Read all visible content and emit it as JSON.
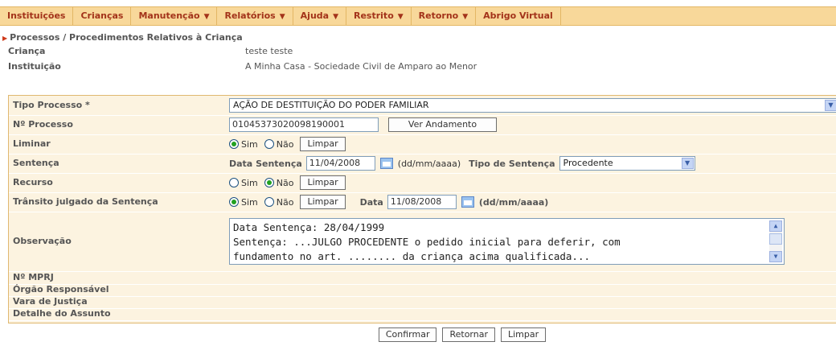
{
  "menu": [
    {
      "label": "Instituições",
      "caret": false
    },
    {
      "label": "Crianças",
      "caret": false
    },
    {
      "label": "Manutenção",
      "caret": true
    },
    {
      "label": "Relatórios",
      "caret": true
    },
    {
      "label": "Ajuda",
      "caret": true
    },
    {
      "label": "Restrito",
      "caret": true
    },
    {
      "label": "Retorno",
      "caret": true
    },
    {
      "label": "Abrigo Virtual",
      "caret": false
    }
  ],
  "breadcrumb": "Processos / Procedimentos Relativos à Criança",
  "header": {
    "crianca_label": "Criança",
    "crianca_value": "teste teste",
    "instituicao_label": "Instituição",
    "instituicao_value": "A Minha Casa - Sociedade Civil de Amparo ao Menor"
  },
  "form": {
    "tipo_processo_label": "Tipo Processo *",
    "tipo_processo_value": "AÇÃO DE DESTITUIÇÃO DO PODER FAMILIAR",
    "numero_processo_label": "Nº Processo",
    "numero_processo_value": "01045373020098190001",
    "ver_andamento_label": "Ver Andamento",
    "liminar_label": "Liminar",
    "sim_label": "Sim",
    "nao_label": "Não",
    "limpar_label": "Limpar",
    "sentenca_label": "Sentença",
    "data_sentenca_label": "Data Sentença",
    "data_sentenca_value": "11/04/2008",
    "date_format": "(dd/mm/aaaa)",
    "tipo_sentenca_label": "Tipo de Sentença",
    "tipo_sentenca_value": "Procedente",
    "recurso_label": "Recurso",
    "transito_label": "Trânsito julgado da Sentença",
    "data_label": "Data",
    "data_transito_value": "11/08/2008",
    "observacao_label": "Observação",
    "observacao_lines": [
      "Data Sentença: 28/04/1999",
      "Sentença: ...JULGO PROCEDENTE o pedido inicial para deferir, com",
      "fundamento no art. ........ da criança acima qualificada..."
    ],
    "mprj_label": "Nº MPRJ",
    "orgao_label": "Órgão Responsável",
    "vara_label": "Vara de Justiça",
    "detalhe_label": "Detalhe do Assunto"
  },
  "buttons": {
    "confirmar": "Confirmar",
    "retornar": "Retornar",
    "limpar": "Limpar"
  }
}
